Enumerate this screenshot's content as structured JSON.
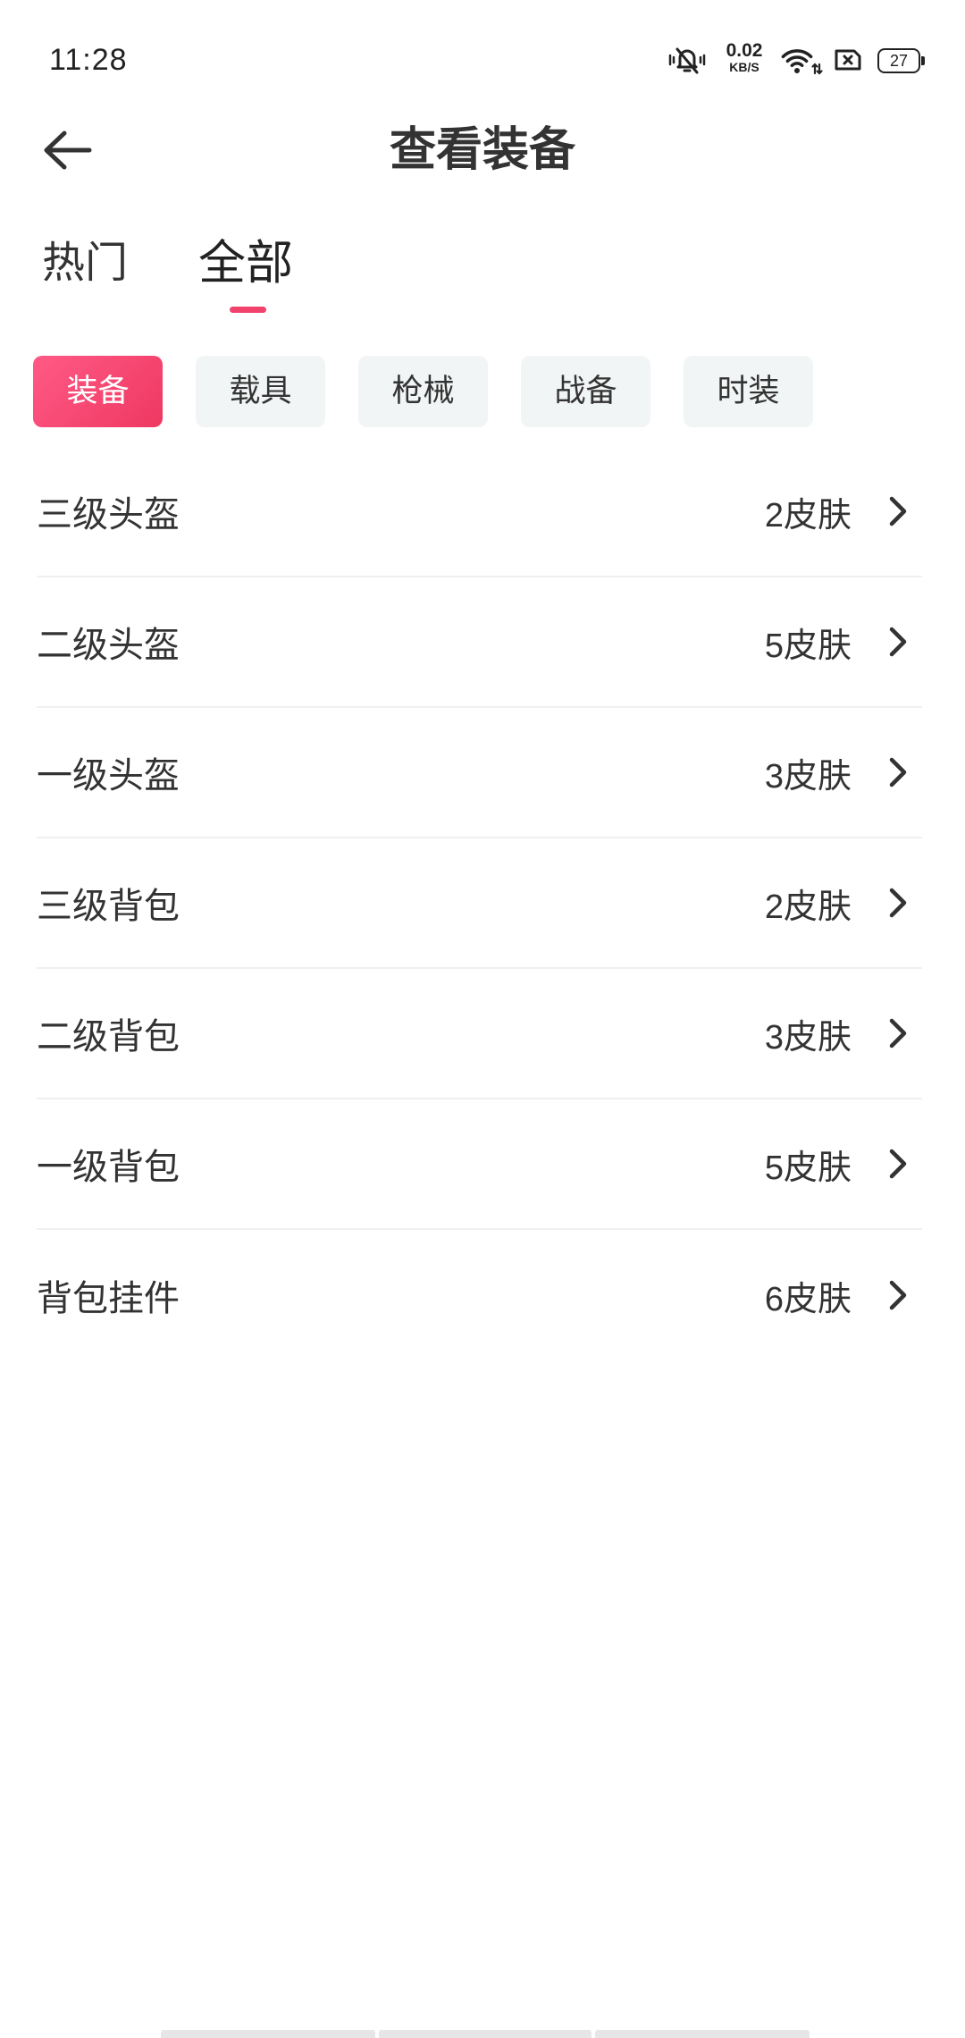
{
  "status_bar": {
    "time": "11:28",
    "net_speed": {
      "value": "0.02",
      "unit": "KB/S"
    },
    "battery_level": "27",
    "icons": [
      "vibrate-off-icon",
      "wifi-icon",
      "sim-no-service-icon",
      "battery-icon"
    ]
  },
  "header": {
    "title": "查看装备",
    "back_icon": "back-arrow-icon"
  },
  "tabs": [
    {
      "label": "热门",
      "active": false
    },
    {
      "label": "全部",
      "active": true
    }
  ],
  "categories": [
    {
      "label": "装备",
      "active": true
    },
    {
      "label": "载具",
      "active": false
    },
    {
      "label": "枪械",
      "active": false
    },
    {
      "label": "战备",
      "active": false
    },
    {
      "label": "时装",
      "active": false
    }
  ],
  "items": [
    {
      "name": "三级头盔",
      "count": "2皮肤"
    },
    {
      "name": "二级头盔",
      "count": "5皮肤"
    },
    {
      "name": "一级头盔",
      "count": "3皮肤"
    },
    {
      "name": "三级背包",
      "count": "2皮肤"
    },
    {
      "name": "二级背包",
      "count": "3皮肤"
    },
    {
      "name": "一级背包",
      "count": "5皮肤"
    },
    {
      "name": "背包挂件",
      "count": "6皮肤"
    }
  ],
  "row_icon": "chevron-right-icon",
  "colors": {
    "accent": "#f2436d",
    "accent_gradient_start": "#ff5a85",
    "accent_gradient_end": "#ee3862",
    "chip_background": "#f2f5f5",
    "text": "#333333",
    "divider": "#f0f0f0"
  }
}
